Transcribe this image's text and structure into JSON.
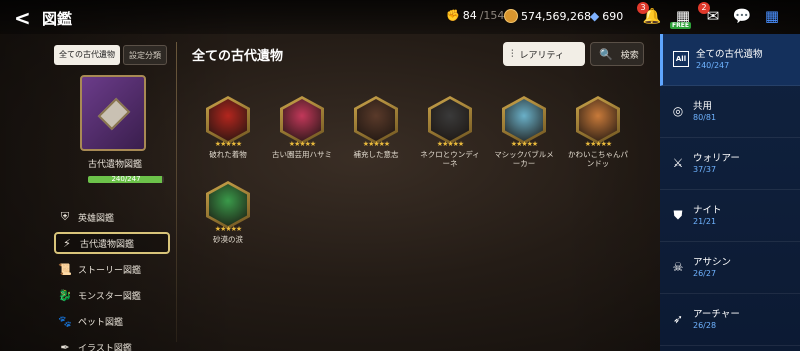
{
  "header": {
    "back_icon": "chevron-left-icon",
    "title": "図鑑",
    "stamina": {
      "current": "84",
      "max": "/154"
    },
    "gold": "574,569,268",
    "gems": "690",
    "notifications": {
      "bell_count": "3",
      "mail_count": "2",
      "free_label": "FREE"
    }
  },
  "left_panel": {
    "tabs": [
      "全ての古代遺物",
      "設定分類"
    ],
    "book_name": "古代遺物図鑑",
    "progress_text": "240/247",
    "progress_fraction": 0.9717,
    "menu": [
      {
        "label": "英雄図鑑",
        "icon": "shield-icon"
      },
      {
        "label": "古代遺物図鑑",
        "icon": "lightning-icon"
      },
      {
        "label": "ストーリー図鑑",
        "icon": "scroll-icon"
      },
      {
        "label": "モンスター図鑑",
        "icon": "dragon-icon"
      },
      {
        "label": "ペット図鑑",
        "icon": "paw-icon"
      },
      {
        "label": "イラスト図鑑",
        "icon": "feather-icon"
      }
    ]
  },
  "main": {
    "section_title": "全ての古代遺物",
    "rarity_button": "レアリティ",
    "search_button": "検索",
    "relics": [
      {
        "name": "破れた着物",
        "stars": "★★★★★",
        "color": "#b3261e"
      },
      {
        "name": "古い園芸用ハサミ",
        "stars": "★★★★★",
        "color": "#c2385a"
      },
      {
        "name": "補充した意志",
        "stars": "★★★★★",
        "color": "#5a3a2a"
      },
      {
        "name": "ネクロとウンディーネ",
        "stars": "★★★★★",
        "color": "#3a3a3a"
      },
      {
        "name": "マシックバブルメーカー",
        "stars": "★★★★★",
        "color": "#6ab0c8"
      },
      {
        "name": "かわいこちゃんパンドッ",
        "stars": "★★★★★",
        "color": "#c87a3a"
      },
      {
        "name": "砂漠の涙",
        "stars": "★★★★★",
        "color": "#3a9a4a"
      }
    ]
  },
  "right_panel": {
    "items": [
      {
        "name": "全ての古代遺物",
        "count": "240/247",
        "icon": "all-icon",
        "icon_text": "All"
      },
      {
        "name": "共用",
        "count": "80/81",
        "icon": "swirl-icon"
      },
      {
        "name": "ウォリアー",
        "count": "37/37",
        "icon": "swords-icon"
      },
      {
        "name": "ナイト",
        "count": "21/21",
        "icon": "shield-icon"
      },
      {
        "name": "アサシン",
        "count": "26/27",
        "icon": "assassin-icon"
      },
      {
        "name": "アーチャー",
        "count": "26/28",
        "icon": "bow-icon"
      }
    ]
  }
}
